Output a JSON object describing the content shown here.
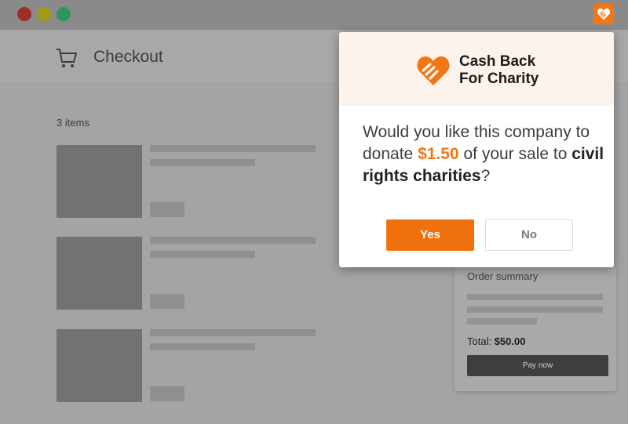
{
  "window": {
    "controls": [
      "close",
      "minimize",
      "maximize"
    ],
    "extension_icon": "heart-hands-icon"
  },
  "header": {
    "cart_icon": "cart-icon",
    "title": "Checkout"
  },
  "cart": {
    "items_count": "3 items"
  },
  "order_summary": {
    "title": "Order summary",
    "total_label": "Total:",
    "total_value": "$50.00",
    "pay_button": "Pay now"
  },
  "popup": {
    "logo_icon": "heart-hands-icon",
    "brand_line1": "Cash Back",
    "brand_line2": "For Charity",
    "question_part1": "Would you like this company to donate ",
    "amount": "$1.50",
    "question_part2": " of your sale to ",
    "cause": "civil rights charities",
    "question_end": "?",
    "yes_label": "Yes",
    "no_label": "No"
  },
  "colors": {
    "accent": "#f07616",
    "popup_header_bg": "#fcf4ec",
    "overlay_bg": "#a6a6a6"
  }
}
